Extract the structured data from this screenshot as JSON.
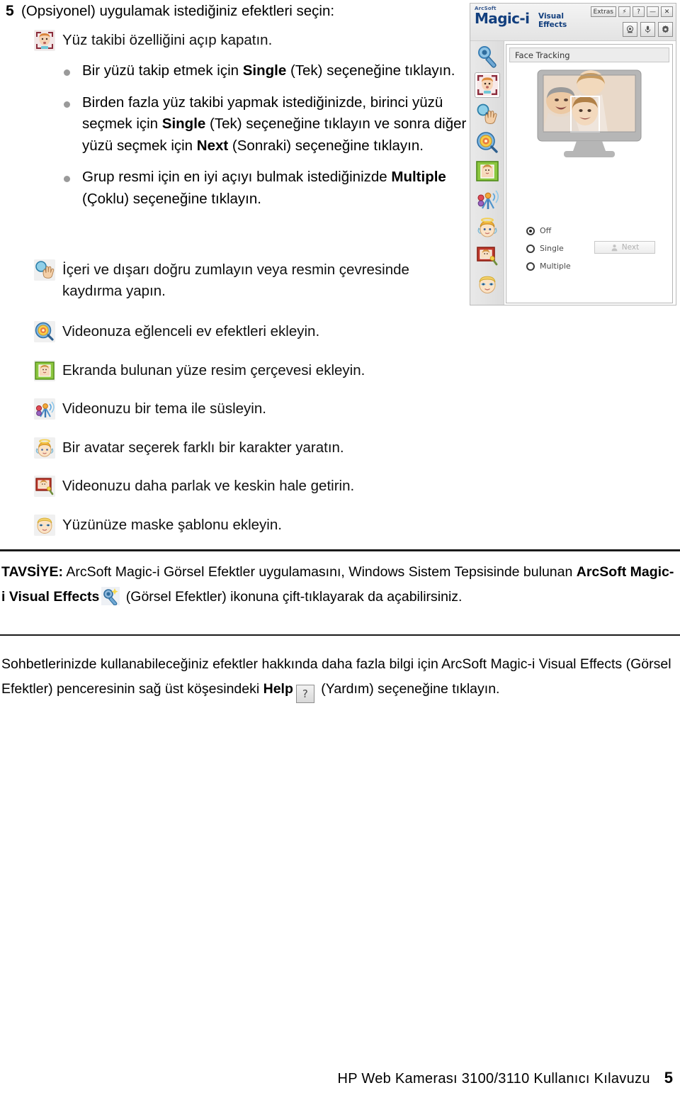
{
  "page": {
    "step_number": "5",
    "step_text": "(Opsiyonel) uygulamak istediğiniz efektleri seçin:"
  },
  "face_tracking": {
    "icon": "face-tracking-icon",
    "text": "Yüz takibi özelliğini açıp kapatın.",
    "bullets": [
      {
        "pre": "Bir yüzü takip etmek için ",
        "bold": "Single",
        "post": " (Tek) seçeneğine tıklayın."
      },
      {
        "pre": "Birden fazla yüz takibi yapmak istediğinizde, birinci yüzü seçmek için ",
        "bold": "Single",
        "mid": " (Tek) seçeneğine tıklayın ve sonra diğer yüzü seçmek için ",
        "bold2": "Next",
        "post": " (Sonraki) seçeneğine tıklayın."
      },
      {
        "pre": "Grup resmi için en iyi açıyı bulmak istediğinizde ",
        "bold": "Multiple",
        "post": " (Çoklu) seçeneğine tıklayın."
      }
    ]
  },
  "effects": [
    {
      "icon": "zoom-pan-hand-icon",
      "text": "İçeri ve dışarı doğru zumlayın veya resmin çevresinde kaydırma yapın."
    },
    {
      "icon": "home-effects-icon",
      "text": "Videonuza eğlenceli ev efektleri ekleyin."
    },
    {
      "icon": "photo-frame-icon",
      "text": "Ekranda bulunan yüze resim çerçevesi ekleyin."
    },
    {
      "icon": "theme-icon",
      "text": "Videonuzu bir tema ile süsleyin."
    },
    {
      "icon": "avatar-icon",
      "text": "Bir avatar seçerek farklı bir karakter yaratın."
    },
    {
      "icon": "enhance-video-icon",
      "text": "Videonuzu daha parlak ve keskin hale getirin."
    },
    {
      "icon": "face-mask-icon",
      "text": "Yüzünüze maske şablonu ekleyin."
    }
  ],
  "app_window": {
    "brand_arcsoft": "ArcSoft",
    "brand_magic": "Magic-i",
    "brand_visual": "Visual",
    "brand_effects": "Effects",
    "titlebar_buttons": [
      {
        "name": "extras-button",
        "label": "Extras"
      },
      {
        "name": "lightning-button",
        "label": "⚡"
      },
      {
        "name": "help-button",
        "label": "?"
      },
      {
        "name": "minimize-button",
        "label": "—"
      },
      {
        "name": "close-button",
        "label": "✕"
      }
    ],
    "toolbar_buttons": [
      {
        "name": "camera-button",
        "label": "camera-icon"
      },
      {
        "name": "microphone-button",
        "label": "microphone-icon"
      },
      {
        "name": "settings-button",
        "label": "gear-icon"
      }
    ],
    "panel_title": "Face Tracking",
    "radio_options": [
      {
        "label": "Off",
        "selected": true
      },
      {
        "label": "Single",
        "selected": false
      },
      {
        "label": "Multiple",
        "selected": false
      }
    ],
    "next_button_label": "Next",
    "sidebar_icons": [
      "magnifier-wrench-icon",
      "face-tracking-icon",
      "zoom-pan-hand-icon",
      "home-effects-icon",
      "photo-frame-icon",
      "theme-icon",
      "avatar-icon",
      "enhance-video-icon",
      "face-mask-icon"
    ]
  },
  "tip": {
    "label": "TAVSİYE:",
    "part1": " ArcSoft Magic-i Görsel Efektler uygulamasını, Windows Sistem Tepsisinde bulunan ",
    "bold": "ArcSoft Magic-i Visual Effects",
    "part2": " (Görsel Efektler) ikonuna çift-tıklayarak da açabilirsiniz."
  },
  "help_note": {
    "part1": "Sohbetlerinizde kullanabileceğiniz efektler hakkında daha fazla bilgi için ArcSoft Magic-i Visual Effects (Görsel Efektler) penceresinin sağ üst köşesindeki ",
    "bold": "Help",
    "help_icon_glyph": "?",
    "part2": " (Yardım) seçeneğine tıklayın."
  },
  "footer": {
    "text": "HP Web Kamerası 3100/3110 Kullanıcı Kılavuzu",
    "page_number": "5"
  }
}
